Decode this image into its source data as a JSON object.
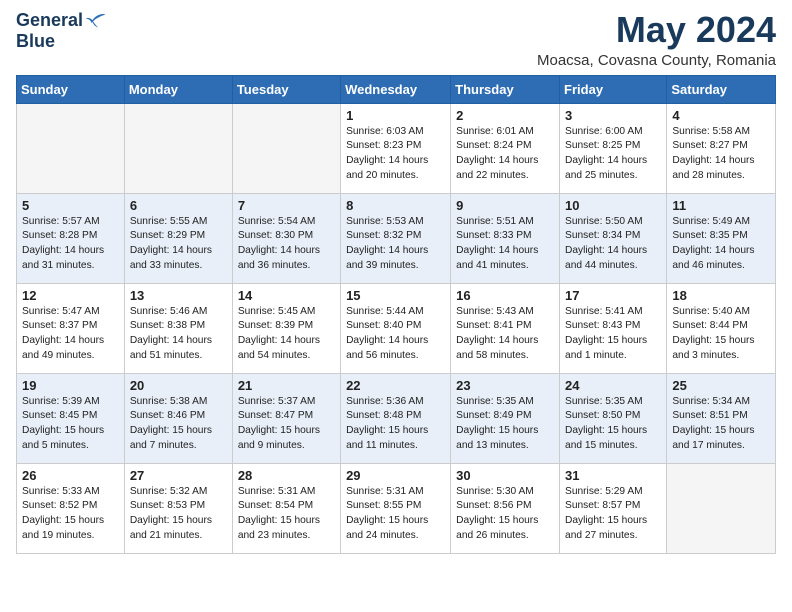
{
  "header": {
    "logo_general": "General",
    "logo_blue": "Blue",
    "title": "May 2024",
    "location": "Moacsa, Covasna County, Romania"
  },
  "weekdays": [
    "Sunday",
    "Monday",
    "Tuesday",
    "Wednesday",
    "Thursday",
    "Friday",
    "Saturday"
  ],
  "weeks": [
    [
      {
        "day": "",
        "empty": true
      },
      {
        "day": "",
        "empty": true
      },
      {
        "day": "",
        "empty": true
      },
      {
        "day": "1",
        "rise": "6:03 AM",
        "set": "8:23 PM",
        "daylight": "14 hours and 20 minutes."
      },
      {
        "day": "2",
        "rise": "6:01 AM",
        "set": "8:24 PM",
        "daylight": "14 hours and 22 minutes."
      },
      {
        "day": "3",
        "rise": "6:00 AM",
        "set": "8:25 PM",
        "daylight": "14 hours and 25 minutes."
      },
      {
        "day": "4",
        "rise": "5:58 AM",
        "set": "8:27 PM",
        "daylight": "14 hours and 28 minutes."
      }
    ],
    [
      {
        "day": "5",
        "rise": "5:57 AM",
        "set": "8:28 PM",
        "daylight": "14 hours and 31 minutes."
      },
      {
        "day": "6",
        "rise": "5:55 AM",
        "set": "8:29 PM",
        "daylight": "14 hours and 33 minutes."
      },
      {
        "day": "7",
        "rise": "5:54 AM",
        "set": "8:30 PM",
        "daylight": "14 hours and 36 minutes."
      },
      {
        "day": "8",
        "rise": "5:53 AM",
        "set": "8:32 PM",
        "daylight": "14 hours and 39 minutes."
      },
      {
        "day": "9",
        "rise": "5:51 AM",
        "set": "8:33 PM",
        "daylight": "14 hours and 41 minutes."
      },
      {
        "day": "10",
        "rise": "5:50 AM",
        "set": "8:34 PM",
        "daylight": "14 hours and 44 minutes."
      },
      {
        "day": "11",
        "rise": "5:49 AM",
        "set": "8:35 PM",
        "daylight": "14 hours and 46 minutes."
      }
    ],
    [
      {
        "day": "12",
        "rise": "5:47 AM",
        "set": "8:37 PM",
        "daylight": "14 hours and 49 minutes."
      },
      {
        "day": "13",
        "rise": "5:46 AM",
        "set": "8:38 PM",
        "daylight": "14 hours and 51 minutes."
      },
      {
        "day": "14",
        "rise": "5:45 AM",
        "set": "8:39 PM",
        "daylight": "14 hours and 54 minutes."
      },
      {
        "day": "15",
        "rise": "5:44 AM",
        "set": "8:40 PM",
        "daylight": "14 hours and 56 minutes."
      },
      {
        "day": "16",
        "rise": "5:43 AM",
        "set": "8:41 PM",
        "daylight": "14 hours and 58 minutes."
      },
      {
        "day": "17",
        "rise": "5:41 AM",
        "set": "8:43 PM",
        "daylight": "15 hours and 1 minute."
      },
      {
        "day": "18",
        "rise": "5:40 AM",
        "set": "8:44 PM",
        "daylight": "15 hours and 3 minutes."
      }
    ],
    [
      {
        "day": "19",
        "rise": "5:39 AM",
        "set": "8:45 PM",
        "daylight": "15 hours and 5 minutes."
      },
      {
        "day": "20",
        "rise": "5:38 AM",
        "set": "8:46 PM",
        "daylight": "15 hours and 7 minutes."
      },
      {
        "day": "21",
        "rise": "5:37 AM",
        "set": "8:47 PM",
        "daylight": "15 hours and 9 minutes."
      },
      {
        "day": "22",
        "rise": "5:36 AM",
        "set": "8:48 PM",
        "daylight": "15 hours and 11 minutes."
      },
      {
        "day": "23",
        "rise": "5:35 AM",
        "set": "8:49 PM",
        "daylight": "15 hours and 13 minutes."
      },
      {
        "day": "24",
        "rise": "5:35 AM",
        "set": "8:50 PM",
        "daylight": "15 hours and 15 minutes."
      },
      {
        "day": "25",
        "rise": "5:34 AM",
        "set": "8:51 PM",
        "daylight": "15 hours and 17 minutes."
      }
    ],
    [
      {
        "day": "26",
        "rise": "5:33 AM",
        "set": "8:52 PM",
        "daylight": "15 hours and 19 minutes."
      },
      {
        "day": "27",
        "rise": "5:32 AM",
        "set": "8:53 PM",
        "daylight": "15 hours and 21 minutes."
      },
      {
        "day": "28",
        "rise": "5:31 AM",
        "set": "8:54 PM",
        "daylight": "15 hours and 23 minutes."
      },
      {
        "day": "29",
        "rise": "5:31 AM",
        "set": "8:55 PM",
        "daylight": "15 hours and 24 minutes."
      },
      {
        "day": "30",
        "rise": "5:30 AM",
        "set": "8:56 PM",
        "daylight": "15 hours and 26 minutes."
      },
      {
        "day": "31",
        "rise": "5:29 AM",
        "set": "8:57 PM",
        "daylight": "15 hours and 27 minutes."
      },
      {
        "day": "",
        "empty": true
      }
    ]
  ],
  "labels": {
    "sunrise": "Sunrise:",
    "sunset": "Sunset:",
    "daylight": "Daylight:"
  }
}
